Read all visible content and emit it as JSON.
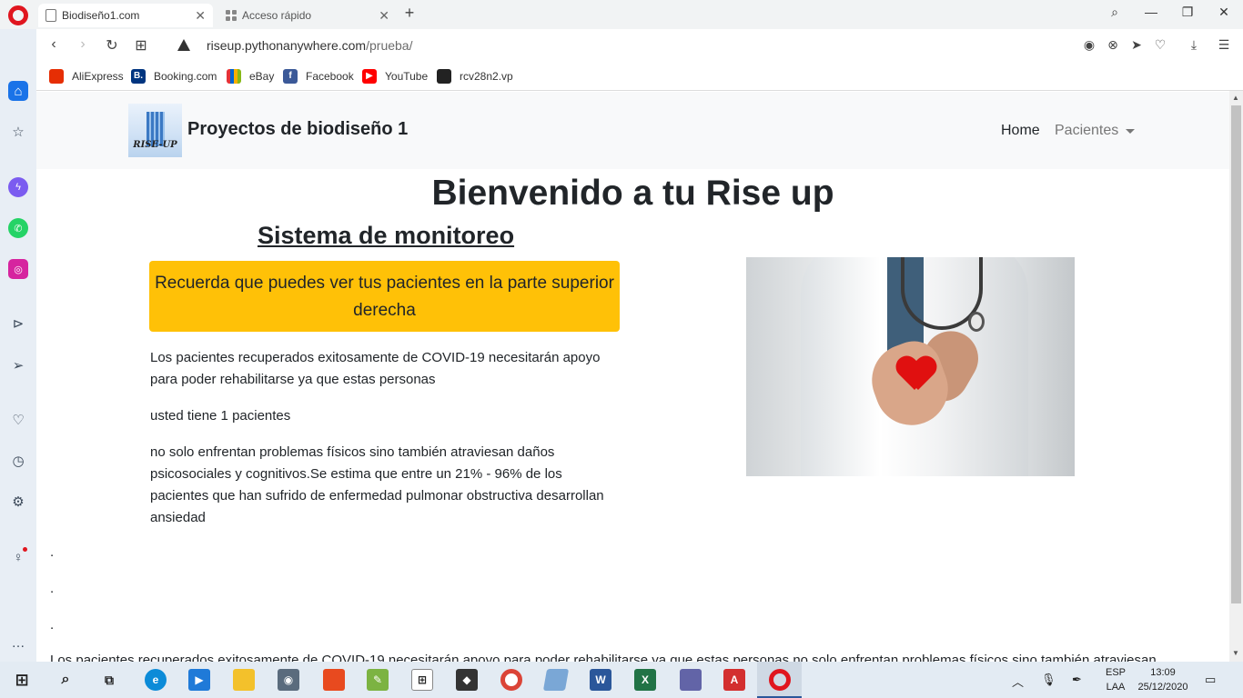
{
  "browser": {
    "tabs": [
      {
        "label": "Biodiseño1.com",
        "active": true
      },
      {
        "label": "Acceso rápido",
        "active": false
      }
    ],
    "url_domain": "riseup.pythonanywhere.com",
    "url_path": "/prueba/",
    "bookmarks": [
      {
        "label": "AliExpress",
        "color": "#e62e04"
      },
      {
        "label": "Booking.com",
        "color": "#003580"
      },
      {
        "label": "eBay",
        "color": "#e53238"
      },
      {
        "label": "Facebook",
        "color": "#3b5998"
      },
      {
        "label": "YouTube",
        "color": "#ff0000"
      },
      {
        "label": "rcv28n2.vp",
        "color": "#222222"
      }
    ]
  },
  "navbar": {
    "brand": "Proyectos de biodiseño 1",
    "logo_text": "RISE-UP",
    "home": "Home",
    "pacientes": "Pacientes"
  },
  "main": {
    "title": "Bienvenido a tu Rise up",
    "subtitle": "Sistema de monitoreo",
    "alert": "Recuerda que puedes ver tus pacientes en la parte superior derecha",
    "paragraph1": "Los pacientes recuperados exitosamente de COVID-19 necesitarán apoyo para poder rehabilitarse ya que estas personas",
    "patient_count": "usted tiene 1 pacientes",
    "paragraph2": "no solo enfrentan problemas físicos sino también atraviesan daños psicosociales y cognitivos.Se estima que entre un 21% - 96% de los pacientes que han sufrido de enfermedad pulmonar obstructiva desarrollan ansiedad",
    "dots": [
      ".",
      ".",
      "."
    ],
    "cut_text": "Los pacientes recuperados exitosamente de COVID-19 necesitarán apoyo para poder rehabilitarse ya que estas personas no solo enfrentan problemas físicos sino también atraviesan"
  },
  "taskbar": {
    "lang_top": "ESP",
    "lang_bottom": "LAA",
    "time": "13:09",
    "date": "25/12/2020"
  },
  "colors": {
    "alert_bg": "#ffc107",
    "opera_red": "#e0161f",
    "navbar_bg": "#f8f9fa"
  }
}
